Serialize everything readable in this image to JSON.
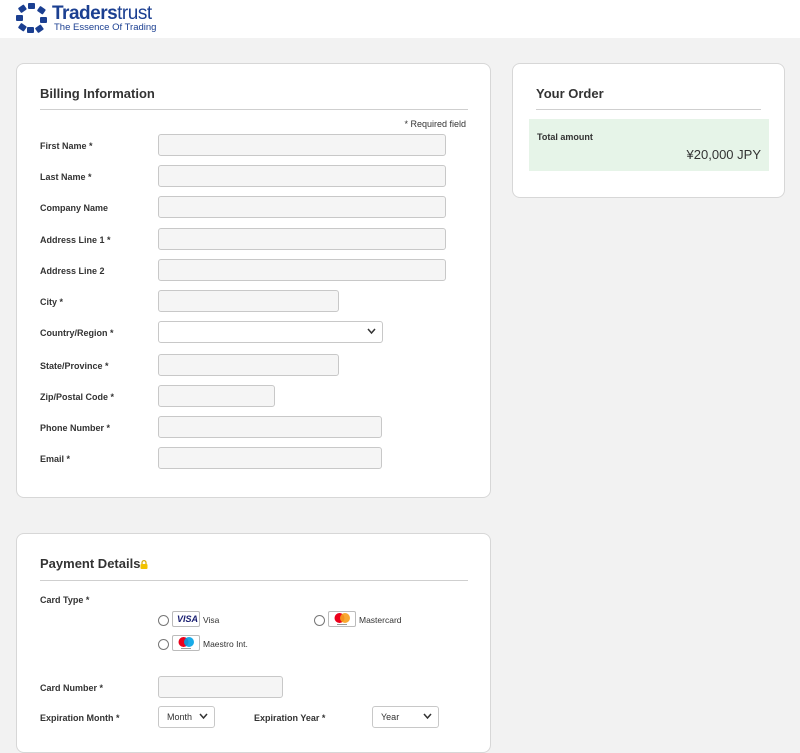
{
  "brand": {
    "name_bold": "Traders",
    "name_light": "trust",
    "tagline": "The Essence Of Trading"
  },
  "billing": {
    "title": "Billing Information",
    "required_note": "* Required field",
    "fields": {
      "first_name": {
        "label": "First Name *",
        "value": ""
      },
      "last_name": {
        "label": "Last Name *",
        "value": ""
      },
      "company": {
        "label": "Company Name",
        "value": ""
      },
      "address1": {
        "label": "Address Line 1 *",
        "value": ""
      },
      "address2": {
        "label": "Address Line 2",
        "value": ""
      },
      "city": {
        "label": "City *",
        "value": ""
      },
      "country": {
        "label": "Country/Region *",
        "value": ""
      },
      "state": {
        "label": "State/Province *",
        "value": ""
      },
      "zip": {
        "label": "Zip/Postal Code *",
        "value": ""
      },
      "phone": {
        "label": "Phone Number *",
        "value": ""
      },
      "email": {
        "label": "Email *",
        "value": ""
      }
    }
  },
  "order": {
    "title": "Your Order",
    "total_label": "Total amount",
    "total_value": "¥20,000 JPY"
  },
  "payment": {
    "title": "Payment Details",
    "card_type_label": "Card Type *",
    "card_options": [
      {
        "name": "Visa",
        "logo_text": "VISA"
      },
      {
        "name": "Mastercard"
      },
      {
        "name": "Maestro Int."
      }
    ],
    "card_number_label": "Card Number *",
    "card_number_value": "",
    "exp_month_label": "Expiration Month *",
    "exp_month_value": "Month",
    "exp_year_label": "Expiration Year *",
    "exp_year_value": "Year"
  },
  "colors": {
    "brand_blue": "#1b3f91",
    "visa_blue": "#1a1f71",
    "mc_red": "#eb001b",
    "mc_orange": "#f79e1b",
    "maestro_blue": "#00a2e5",
    "total_bg": "#e6f4e8",
    "lock_yellow": "#f2c200"
  }
}
